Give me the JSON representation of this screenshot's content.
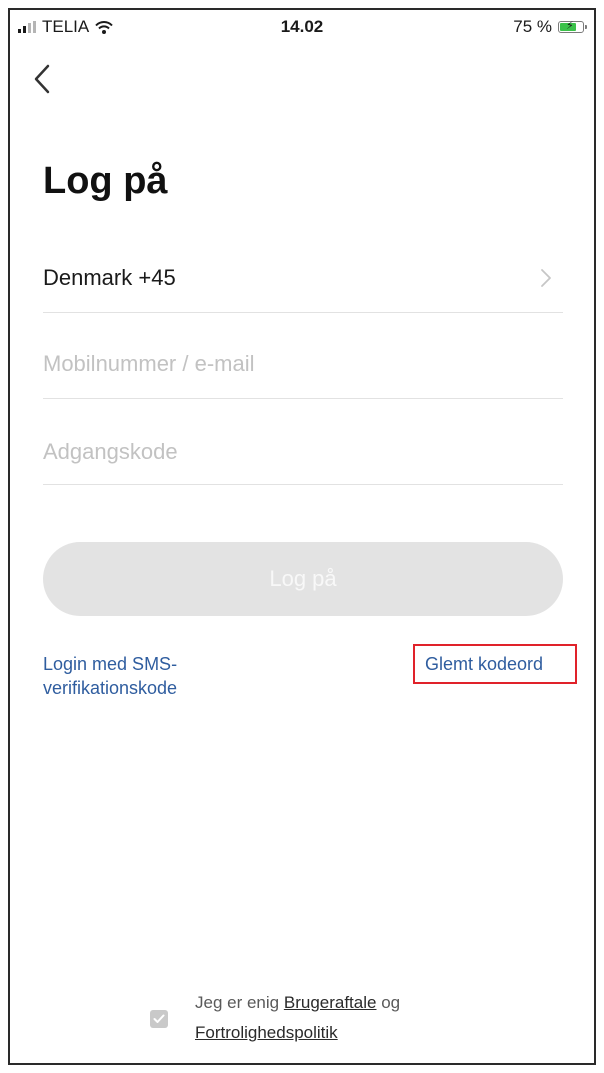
{
  "status_bar": {
    "carrier": "TELIA",
    "time": "14.02",
    "battery": "75 %",
    "battery_level": 0.75
  },
  "nav": {
    "back_icon": "chevron-left-icon"
  },
  "page": {
    "title": "Log på"
  },
  "form": {
    "country": "Denmark +45",
    "phone_placeholder": "Mobilnummer / e-mail",
    "password_placeholder": "Adgangskode",
    "login_button": "Log på"
  },
  "links": {
    "sms_login": "Login med SMS-verifikationskode",
    "forgot_password": "Glemt kodeord"
  },
  "agreement": {
    "prefix": "Jeg er enig",
    "user_agreement": "Brugeraftale",
    "conjunction": "og",
    "privacy_policy": "Fortrolighedspolitik"
  },
  "colors": {
    "link": "#2f5d9f",
    "highlight_box": "#e0222a",
    "button_disabled": "#e3e3e3"
  }
}
